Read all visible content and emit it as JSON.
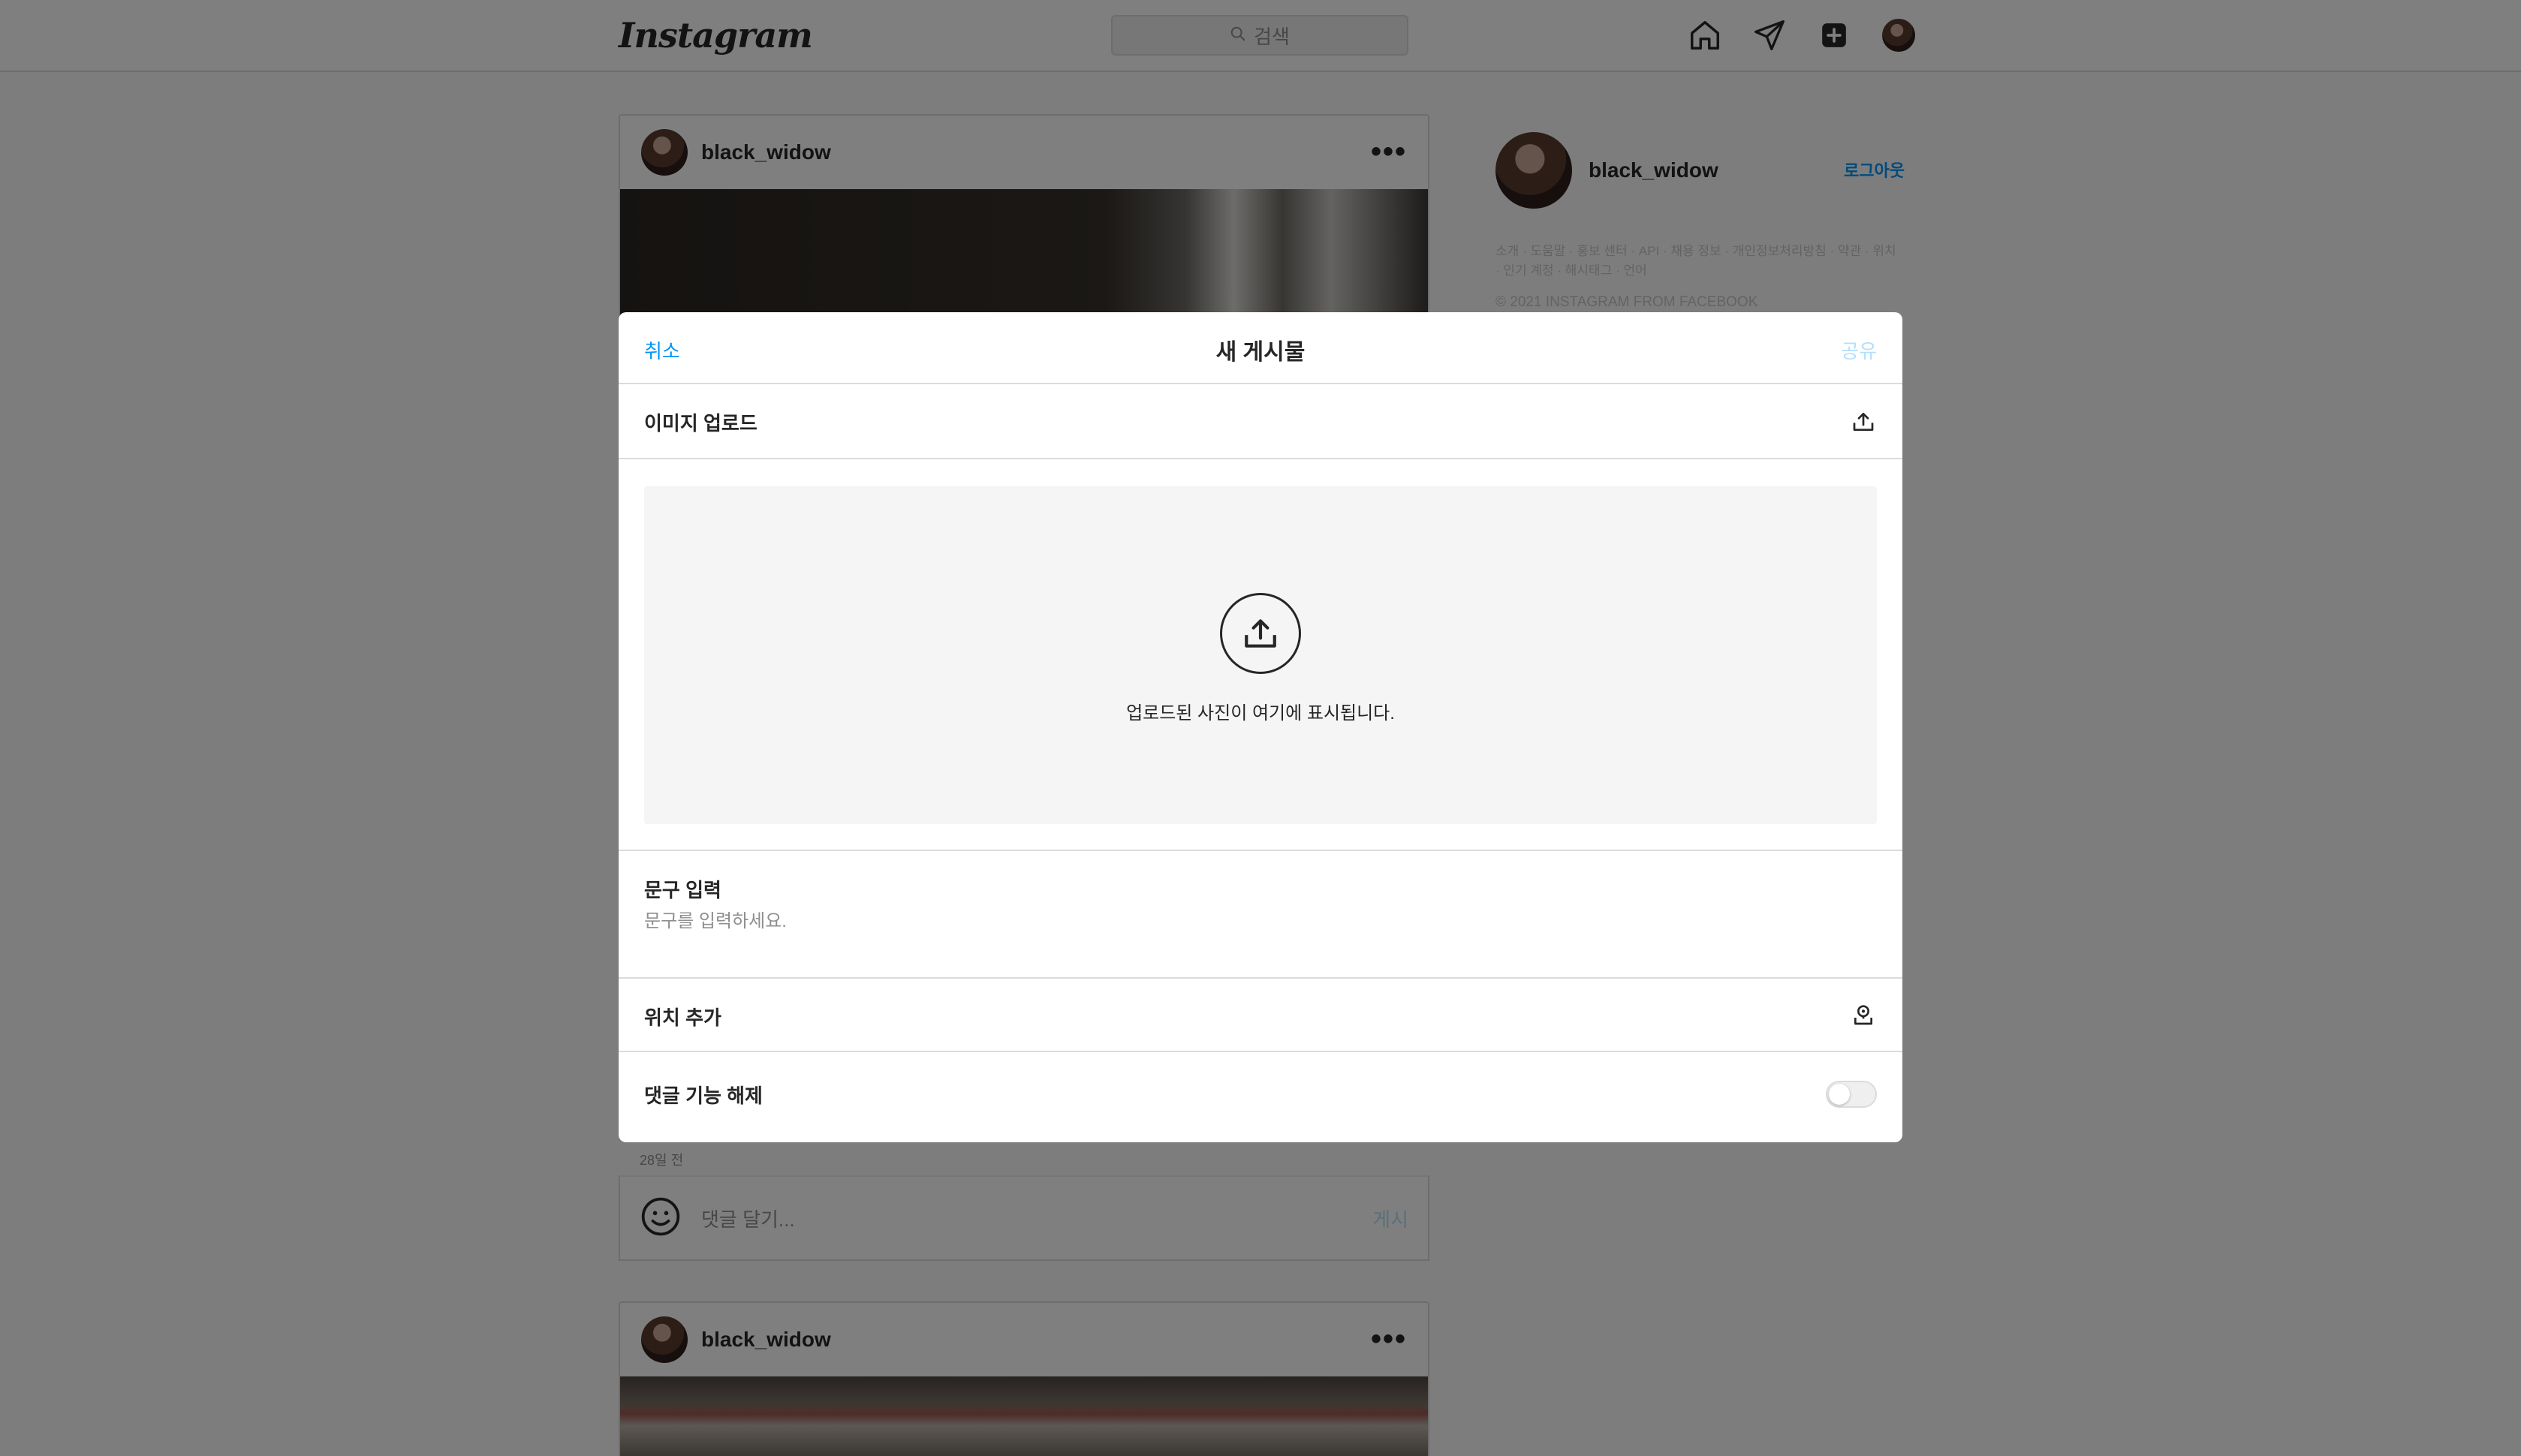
{
  "app": {
    "logo": "Instagram"
  },
  "topbar": {
    "search_placeholder": "검색",
    "icons": [
      "home-icon",
      "paper-plane-icon",
      "new-post-icon",
      "avatar"
    ]
  },
  "feed": {
    "posts": [
      {
        "username": "black_widow",
        "more": "•••"
      },
      {
        "username": "black_widow",
        "more": "•••"
      }
    ],
    "time_ago": "28일 전",
    "comment_placeholder": "댓글 달기...",
    "comment_post": "게시"
  },
  "sidebar": {
    "username": "black_widow",
    "logout": "로그아웃",
    "links": "소개 · 도움말 · 홍보 센터 · API · 채용 정보 · 개인정보처리방침 · 약관 · 위치 · 인기 계정 · 해시태그 · 언어",
    "copyright": "© 2021 INSTAGRAM FROM FACEBOOK"
  },
  "modal": {
    "cancel": "취소",
    "title": "새 게시물",
    "share": "공유",
    "upload_label": "이미지 업로드",
    "dropzone_text": "업로드된 사진이 여기에 표시됩니다.",
    "caption_label": "문구 입력",
    "caption_placeholder": "문구를 입력하세요.",
    "location_label": "위치 추가",
    "comments_label": "댓글 기능 해제",
    "comments_disabled": false
  },
  "colors": {
    "accent": "#0095f6",
    "accent_disabled": "#b2dffc",
    "text": "#262626",
    "muted": "#8e8e8e",
    "border": "#dbdbdb"
  }
}
